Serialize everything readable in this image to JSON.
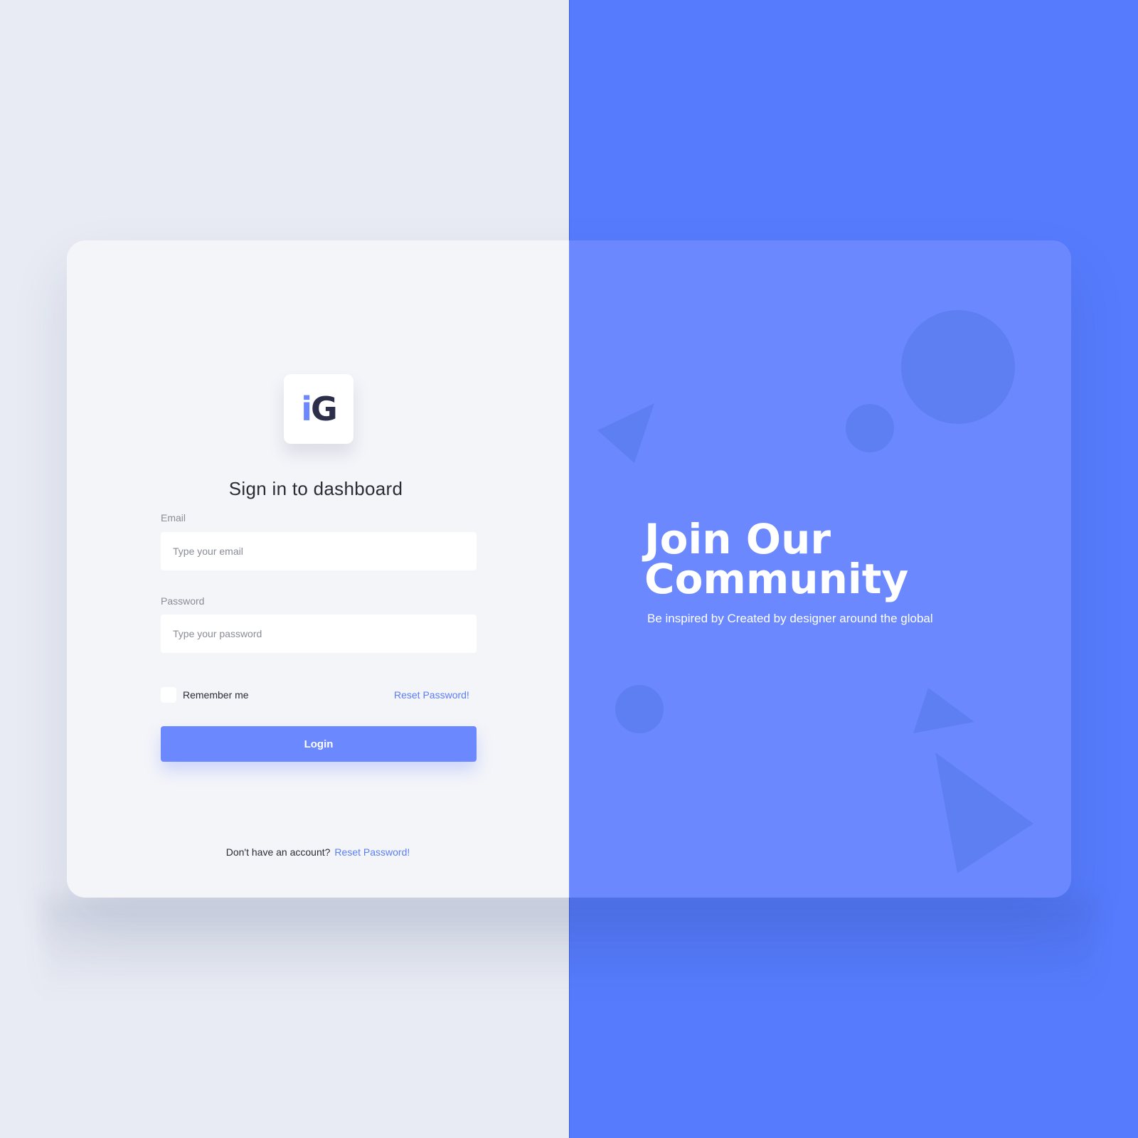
{
  "colors": {
    "page_left_bg": "#e8ebf3",
    "page_right_bg": "#567bfc",
    "card_left_bg": "#f4f5f9",
    "card_right_bg": "#6b88ff",
    "accent": "#6b88ff",
    "link": "#5a7df8"
  },
  "logo": {
    "letter_i": "i",
    "letter_g": "G"
  },
  "signin": {
    "title": "Sign in to dashboard",
    "email_label": "Email",
    "email_placeholder": "Type your email",
    "password_label": "Password",
    "password_placeholder": "Type your password",
    "remember_label": "Remember me",
    "reset_link": "Reset Password!",
    "login_button": "Login",
    "footer_text": "Don't have an account?",
    "footer_link": "Reset Password!"
  },
  "promo": {
    "title_line1": "Join Our",
    "title_line2": "Community",
    "subtitle": "Be inspired by Created by designer around the global"
  }
}
